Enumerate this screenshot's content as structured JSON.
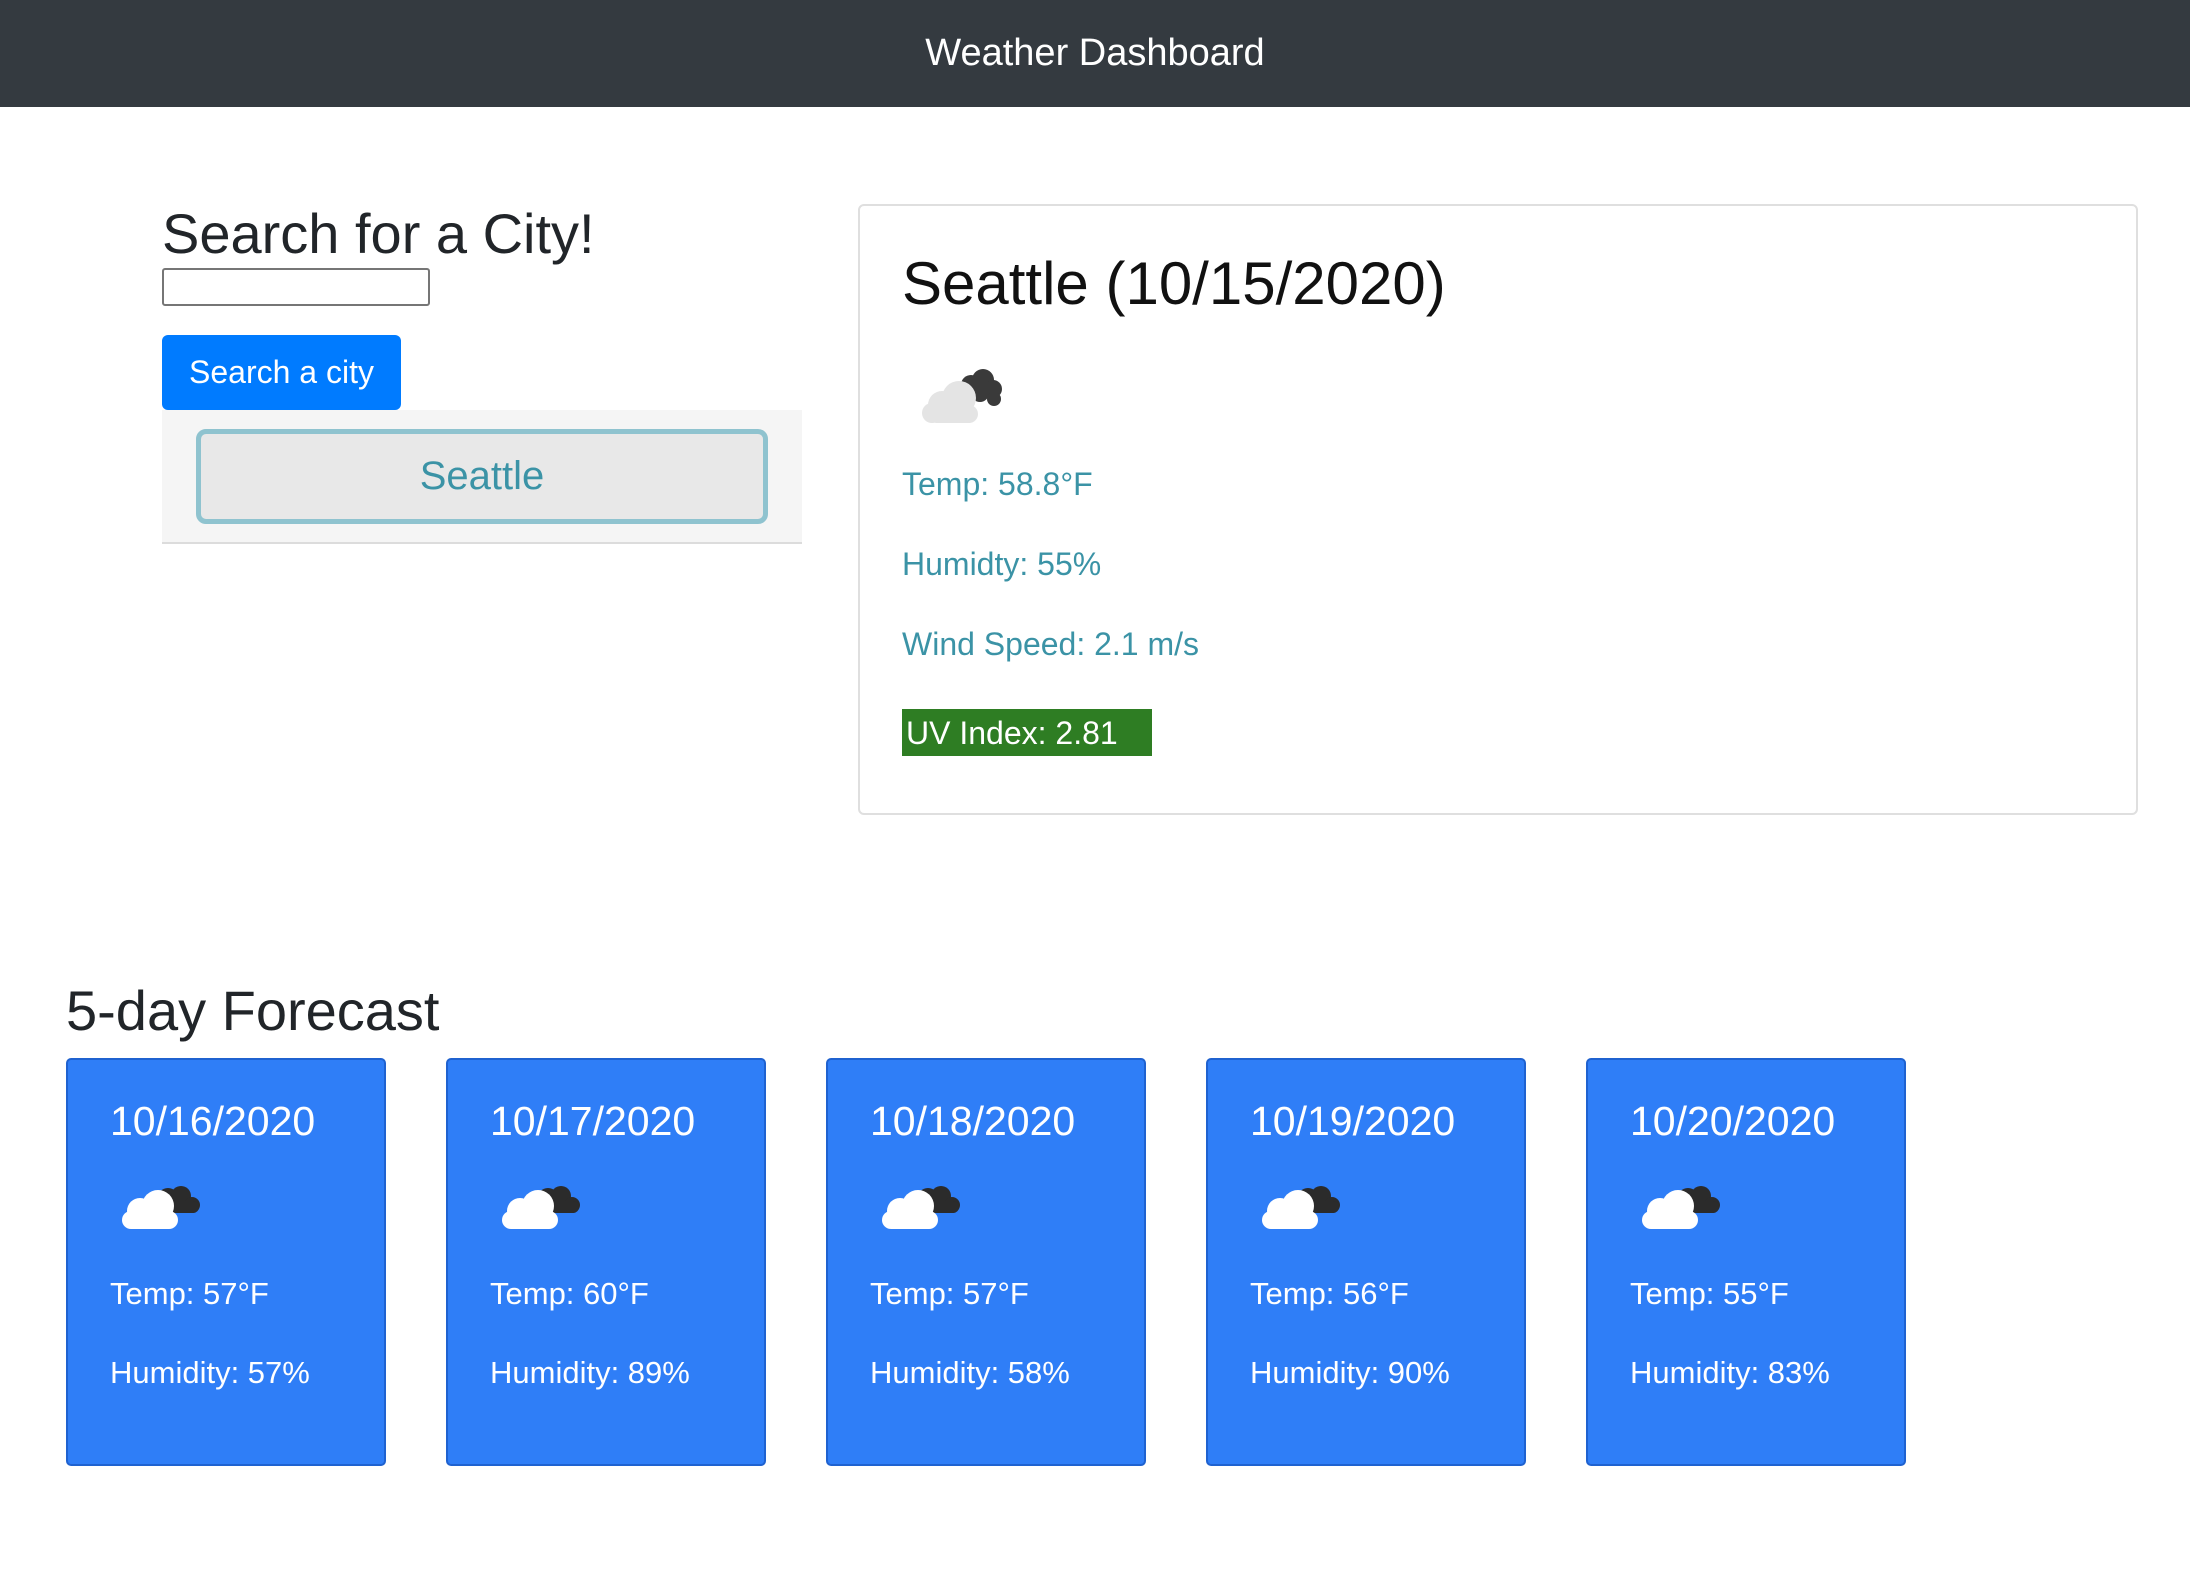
{
  "navbar": {
    "title": "Weather Dashboard"
  },
  "search": {
    "title": "Search for a City!",
    "input_value": "",
    "button_label": "Search a city",
    "history": [
      "Seattle"
    ]
  },
  "current": {
    "title": "Seattle (10/15/2020)",
    "icon": "cloud-icon",
    "temp": "Temp: 58.8°F",
    "humidity": "Humidty: 55%",
    "wind": "Wind Speed: 2.1 m/s",
    "uv": "UV Index: 2.81",
    "uv_color": "#2e7d23"
  },
  "forecast": {
    "title": "5-day Forecast",
    "card_color": "#2f7ef7",
    "days": [
      {
        "date": "10/16/2020",
        "icon": "cloud-icon",
        "temp": "Temp: 57°F",
        "humidity": "Humidity: 57%"
      },
      {
        "date": "10/17/2020",
        "icon": "cloud-icon",
        "temp": "Temp: 60°F",
        "humidity": "Humidity: 89%"
      },
      {
        "date": "10/18/2020",
        "icon": "cloud-icon",
        "temp": "Temp: 57°F",
        "humidity": "Humidity: 58%"
      },
      {
        "date": "10/19/2020",
        "icon": "cloud-icon",
        "temp": "Temp: 56°F",
        "humidity": "Humidity: 90%"
      },
      {
        "date": "10/20/2020",
        "icon": "cloud-icon",
        "temp": "Temp: 55°F",
        "humidity": "Humidity: 83%"
      }
    ]
  }
}
